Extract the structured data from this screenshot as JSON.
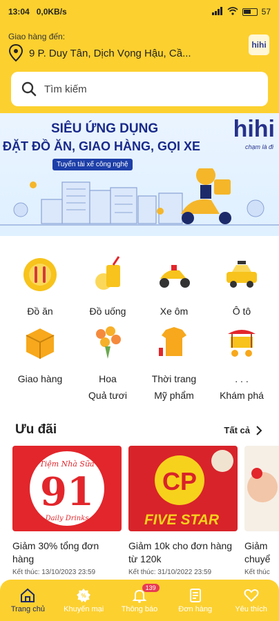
{
  "status_bar": {
    "time": "13:04",
    "network_speed": "0,0KB/s",
    "battery": "57"
  },
  "header": {
    "delivery_label": "Giao hàng đến:",
    "address": "9 P. Duy Tân, Dịch Vọng Hậu, Cầ...",
    "logo_text": "hihi",
    "search_placeholder": "Tìm kiếm"
  },
  "banner": {
    "line1": "SIÊU ỨNG DỤNG",
    "line2": "ĐẶT ĐỒ ĂN, GIAO HÀNG, GỌI XE",
    "tag": "Tuyển tài xế công nghệ",
    "brand": "hihi",
    "brand_sub": "chạm là đi"
  },
  "categories": [
    {
      "label": "Đồ ăn",
      "icon": "food-icon"
    },
    {
      "label": "Đồ uống",
      "icon": "drink-icon"
    },
    {
      "label": "Xe ôm",
      "icon": "motorbike-icon"
    },
    {
      "label": "Ô tô",
      "icon": "taxi-icon"
    },
    {
      "label": "Giao hàng",
      "icon": "box-icon"
    },
    {
      "label": "Hoa",
      "label2": "Quả tươi",
      "icon": "flower-icon"
    },
    {
      "label": "Thời trang",
      "label2": "Mỹ phẩm",
      "icon": "fashion-icon"
    },
    {
      "label": ". . .",
      "label2": "Khám phá",
      "icon": "explore-cart-icon"
    }
  ],
  "promotions": {
    "heading": "Ưu đãi",
    "see_all": "Tất cả",
    "items": [
      {
        "title": "Giảm 30% tổng đơn hàng",
        "end": "Kết thúc: 13/10/2023 23:59",
        "image_text": "91",
        "image_brand": "Tiệm Nhà Sữa",
        "image_sub": "Daily Drinks"
      },
      {
        "title": "Giảm 10k cho đơn hàng từ 120k",
        "end": "Kết thúc: 31/10/2022 23:59",
        "image_text": "CP",
        "image_sub": "FIVE STAR"
      },
      {
        "title": "Giảm chuyể",
        "end": "Kết thúc",
        "image_text": ""
      }
    ]
  },
  "tabbar": {
    "items": [
      {
        "label": "Trang chủ",
        "icon": "home-icon",
        "active": true
      },
      {
        "label": "Khuyến mại",
        "icon": "discount-icon"
      },
      {
        "label": "Thông báo",
        "icon": "bell-icon",
        "badge": "139"
      },
      {
        "label": "Đơn hàng",
        "icon": "orders-icon"
      },
      {
        "label": "Yêu thích",
        "icon": "heart-icon"
      }
    ]
  },
  "colors": {
    "brand_yellow": "#fcd02f",
    "brand_navy": "#1a2a8a",
    "badge_red": "#e83a52",
    "promo_red": "#e2262b"
  }
}
